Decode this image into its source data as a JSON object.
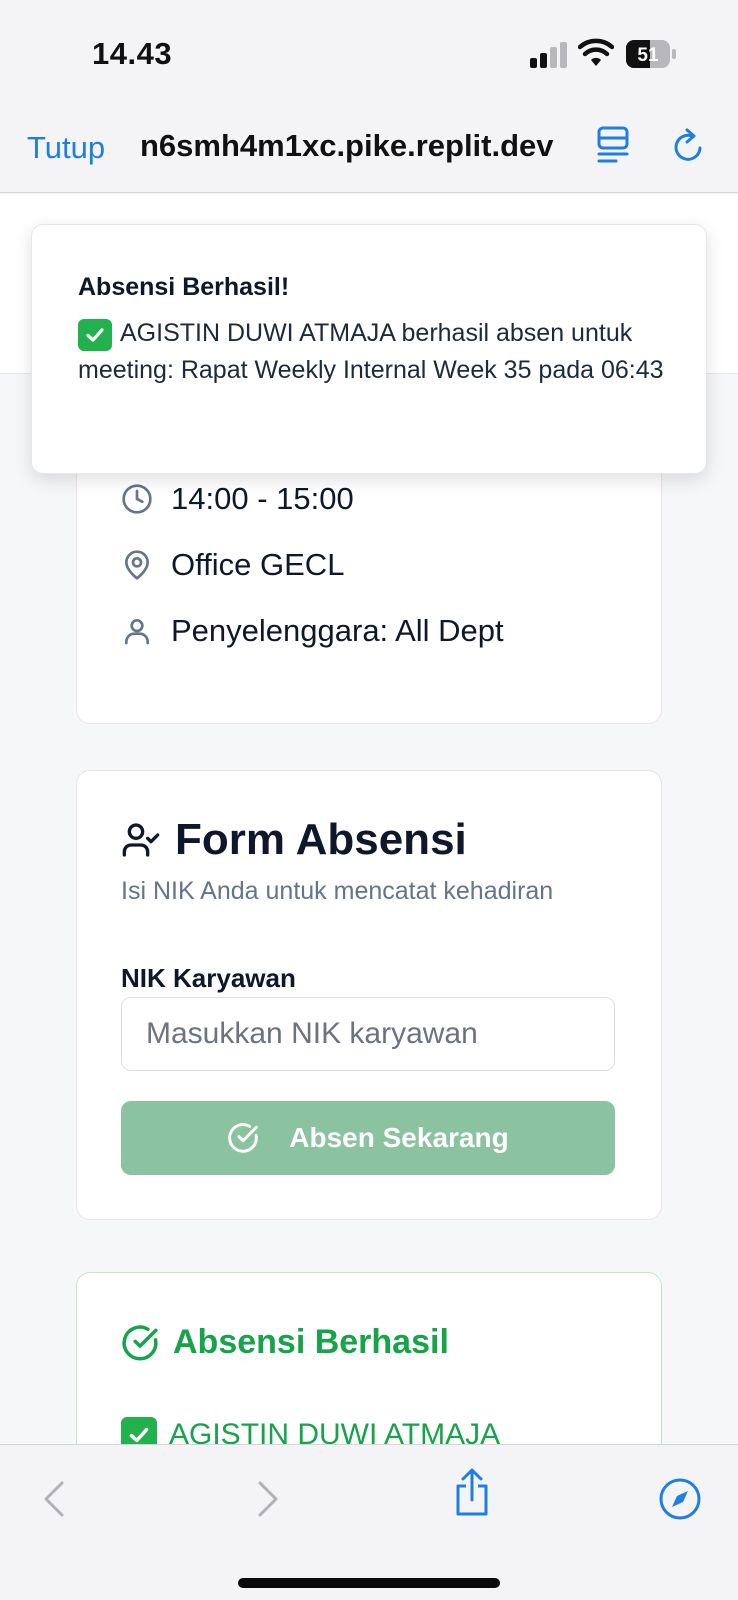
{
  "status_bar": {
    "time": "14.43",
    "battery_level": "51"
  },
  "browser": {
    "close_label": "Tutup",
    "url": "n6smh4m1xc.pike.replit.dev"
  },
  "toast": {
    "title": "Absensi Berhasil!",
    "message": "AGISTIN DUWI ATMAJA berhasil absen untuk meeting: Rapat Weekly Internal Week 35 pada 06:43"
  },
  "meeting": {
    "time": "14:00 - 15:00",
    "location": "Office GECL",
    "organizer": "Penyelenggara: All Dept"
  },
  "form": {
    "title": "Form Absensi",
    "subtitle": "Isi NIK Anda untuk mencatat kehadiran",
    "nik_label": "NIK Karyawan",
    "nik_placeholder": "Masukkan NIK karyawan",
    "nik_value": "",
    "submit_label": "Absen Sekarang"
  },
  "success": {
    "title": "Absensi Berhasil",
    "message": "AGISTIN DUWI ATMAJA"
  },
  "colors": {
    "accent_blue": "#1f7fe0",
    "success_green": "#16a34a",
    "button_green": "#8bc29f"
  },
  "icons": [
    "clock-icon",
    "map-pin-icon",
    "user-icon",
    "user-check-icon",
    "check-circle-icon",
    "check-emoji-icon",
    "chevron-left-icon",
    "chevron-right-icon",
    "share-icon",
    "compass-icon",
    "reader-icon",
    "reload-icon"
  ]
}
